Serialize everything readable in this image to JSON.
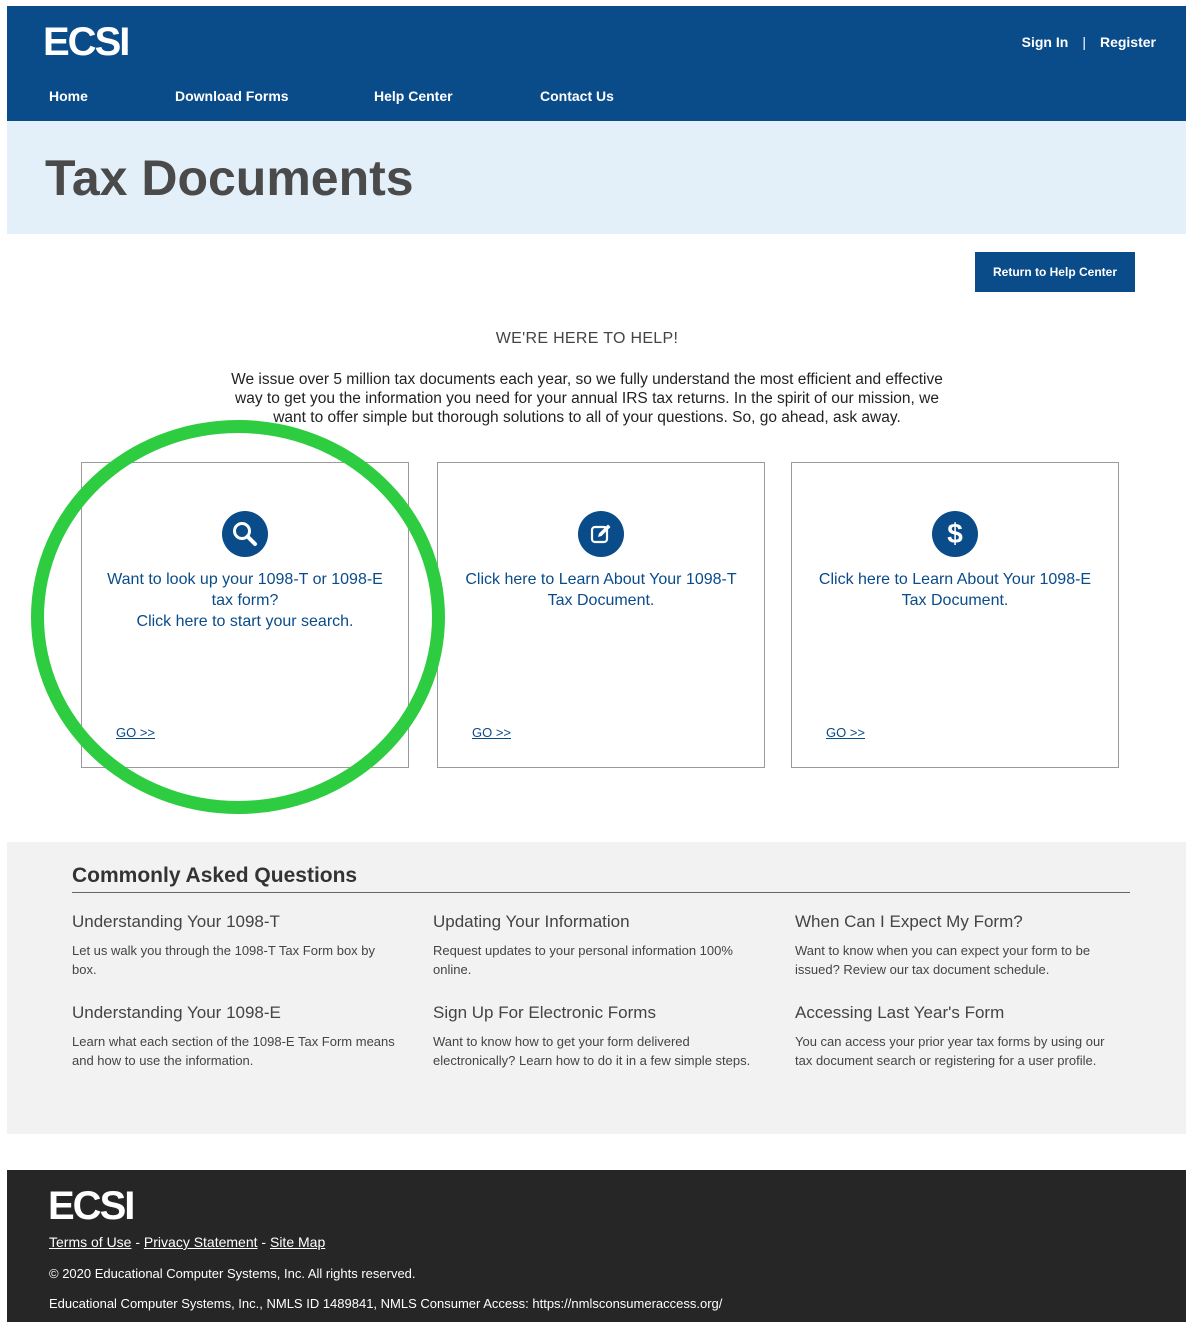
{
  "header": {
    "logo": "ECSI",
    "sign_in": "Sign In",
    "separator": "|",
    "register": "Register",
    "nav": [
      "Home",
      "Download Forms",
      "Help Center",
      "Contact Us"
    ]
  },
  "hero": {
    "title": "Tax Documents"
  },
  "return_button": "Return to Help Center",
  "help": {
    "title": "WE'RE HERE TO HELP!",
    "text": "We issue over 5 million tax documents each year, so we fully understand the most efficient and effective way to get you the information you need for your annual IRS tax returns. In the spirit of our mission, we want to offer simple but thorough solutions to all of your questions. So, go ahead, ask away."
  },
  "cards": [
    {
      "icon": "search-icon",
      "line1": "Want to look up your 1098-T or 1098-E tax form?",
      "line2": "Click here to start your search.",
      "go": "GO >>"
    },
    {
      "icon": "edit-icon",
      "line1": "Click here to Learn About Your 1098-T Tax Document.",
      "line2": "",
      "go": "GO >>"
    },
    {
      "icon": "dollar-icon",
      "line1": "Click here to Learn About Your 1098-E Tax Document.",
      "line2": "",
      "go": "GO >>"
    }
  ],
  "faq": {
    "title": "Commonly Asked Questions",
    "items": [
      {
        "title": "Understanding Your 1098-T",
        "desc": "Let us walk you through the 1098-T Tax Form box by box."
      },
      {
        "title": "Updating Your Information",
        "desc": "Request updates to your personal information 100% online."
      },
      {
        "title": "When Can I Expect My Form?",
        "desc": "Want to know when you can expect your form to be issued? Review our tax document schedule."
      },
      {
        "title": "Understanding Your 1098-E",
        "desc": "Learn what each section of the 1098-E Tax Form means and how to use the information."
      },
      {
        "title": "Sign Up For Electronic Forms",
        "desc": "Want to know how to get your form delivered electronically? Learn how to do it in a few simple steps."
      },
      {
        "title": "Accessing Last Year's Form",
        "desc": "You can access your prior year tax forms by using our tax document search or registering for a user profile."
      }
    ]
  },
  "footer": {
    "logo": "ECSI",
    "terms": "Terms of Use",
    "privacy": "Privacy Statement",
    "sitemap": "Site Map",
    "link_sep": " - ",
    "copyright": "© 2020 Educational Computer Systems, Inc. All rights reserved.",
    "nmls": "Educational Computer Systems, Inc., NMLS ID 1489841, NMLS Consumer Access: https://nmlsconsumeraccess.org/"
  },
  "colors": {
    "brand_blue": "#0a4b8a",
    "highlight_green": "#2ecc40",
    "hero_bg": "#e3f0fa",
    "footer_bg": "#262626"
  }
}
